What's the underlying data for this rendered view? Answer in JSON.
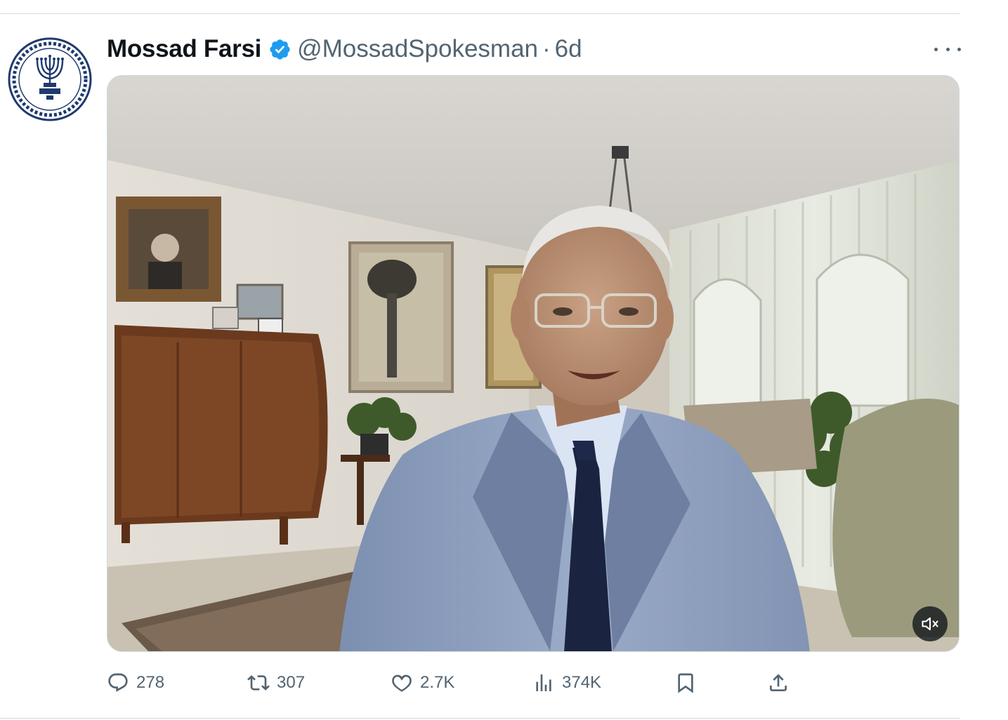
{
  "tweet": {
    "author_name": "Mossad Farsi",
    "handle": "@MossadSpokesman",
    "separator": "·",
    "time": "6d",
    "verified": true,
    "verified_color": "#1d9bf0",
    "avatar": {
      "icon": "mossad-emblem-icon",
      "color": "#1f3a6e"
    },
    "media": {
      "type": "video",
      "muted": true,
      "mute_icon": "speaker-muted-icon"
    }
  },
  "actions": {
    "replies": {
      "icon": "reply-icon",
      "count": "278"
    },
    "retweets": {
      "icon": "retweet-icon",
      "count": "307"
    },
    "likes": {
      "icon": "heart-icon",
      "count": "2.7K"
    },
    "views": {
      "icon": "analytics-icon",
      "count": "374K"
    },
    "bookmark": {
      "icon": "bookmark-icon"
    },
    "share": {
      "icon": "share-icon"
    }
  },
  "colors": {
    "text": "#0f1419",
    "secondary": "#536471",
    "border": "#cfd9de"
  }
}
